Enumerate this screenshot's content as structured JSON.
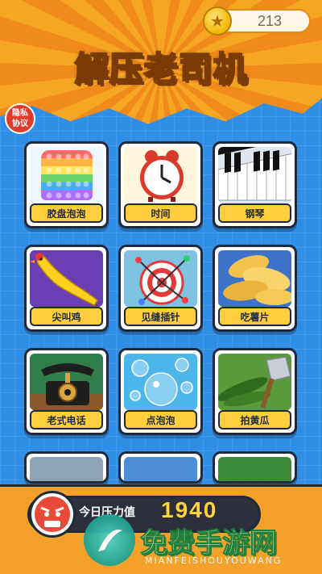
{
  "header": {
    "title": "解压老司机"
  },
  "coins": {
    "value": "213"
  },
  "privacy": {
    "line1": "隐私",
    "line2": "协议"
  },
  "games": [
    {
      "label": "胶盘泡泡",
      "icon": "pop-it-icon"
    },
    {
      "label": "时间",
      "icon": "alarm-clock-icon"
    },
    {
      "label": "钢琴",
      "icon": "piano-icon"
    },
    {
      "label": "尖叫鸡",
      "icon": "rubber-chicken-icon"
    },
    {
      "label": "见缝插针",
      "icon": "target-pins-icon"
    },
    {
      "label": "吃薯片",
      "icon": "potato-chips-icon"
    },
    {
      "label": "老式电话",
      "icon": "vintage-phone-icon"
    },
    {
      "label": "点泡泡",
      "icon": "bubbles-icon"
    },
    {
      "label": "拍黄瓜",
      "icon": "cucumber-icon"
    }
  ],
  "stress": {
    "label": "今日压力值",
    "value": "1940"
  },
  "watermark": {
    "title": "免费手游网",
    "sub": "MIANFEISHOUYOUWANG"
  },
  "colors": {
    "accent": "#f5a623",
    "background": "#2f8fe6",
    "label": "#ffce3d"
  }
}
